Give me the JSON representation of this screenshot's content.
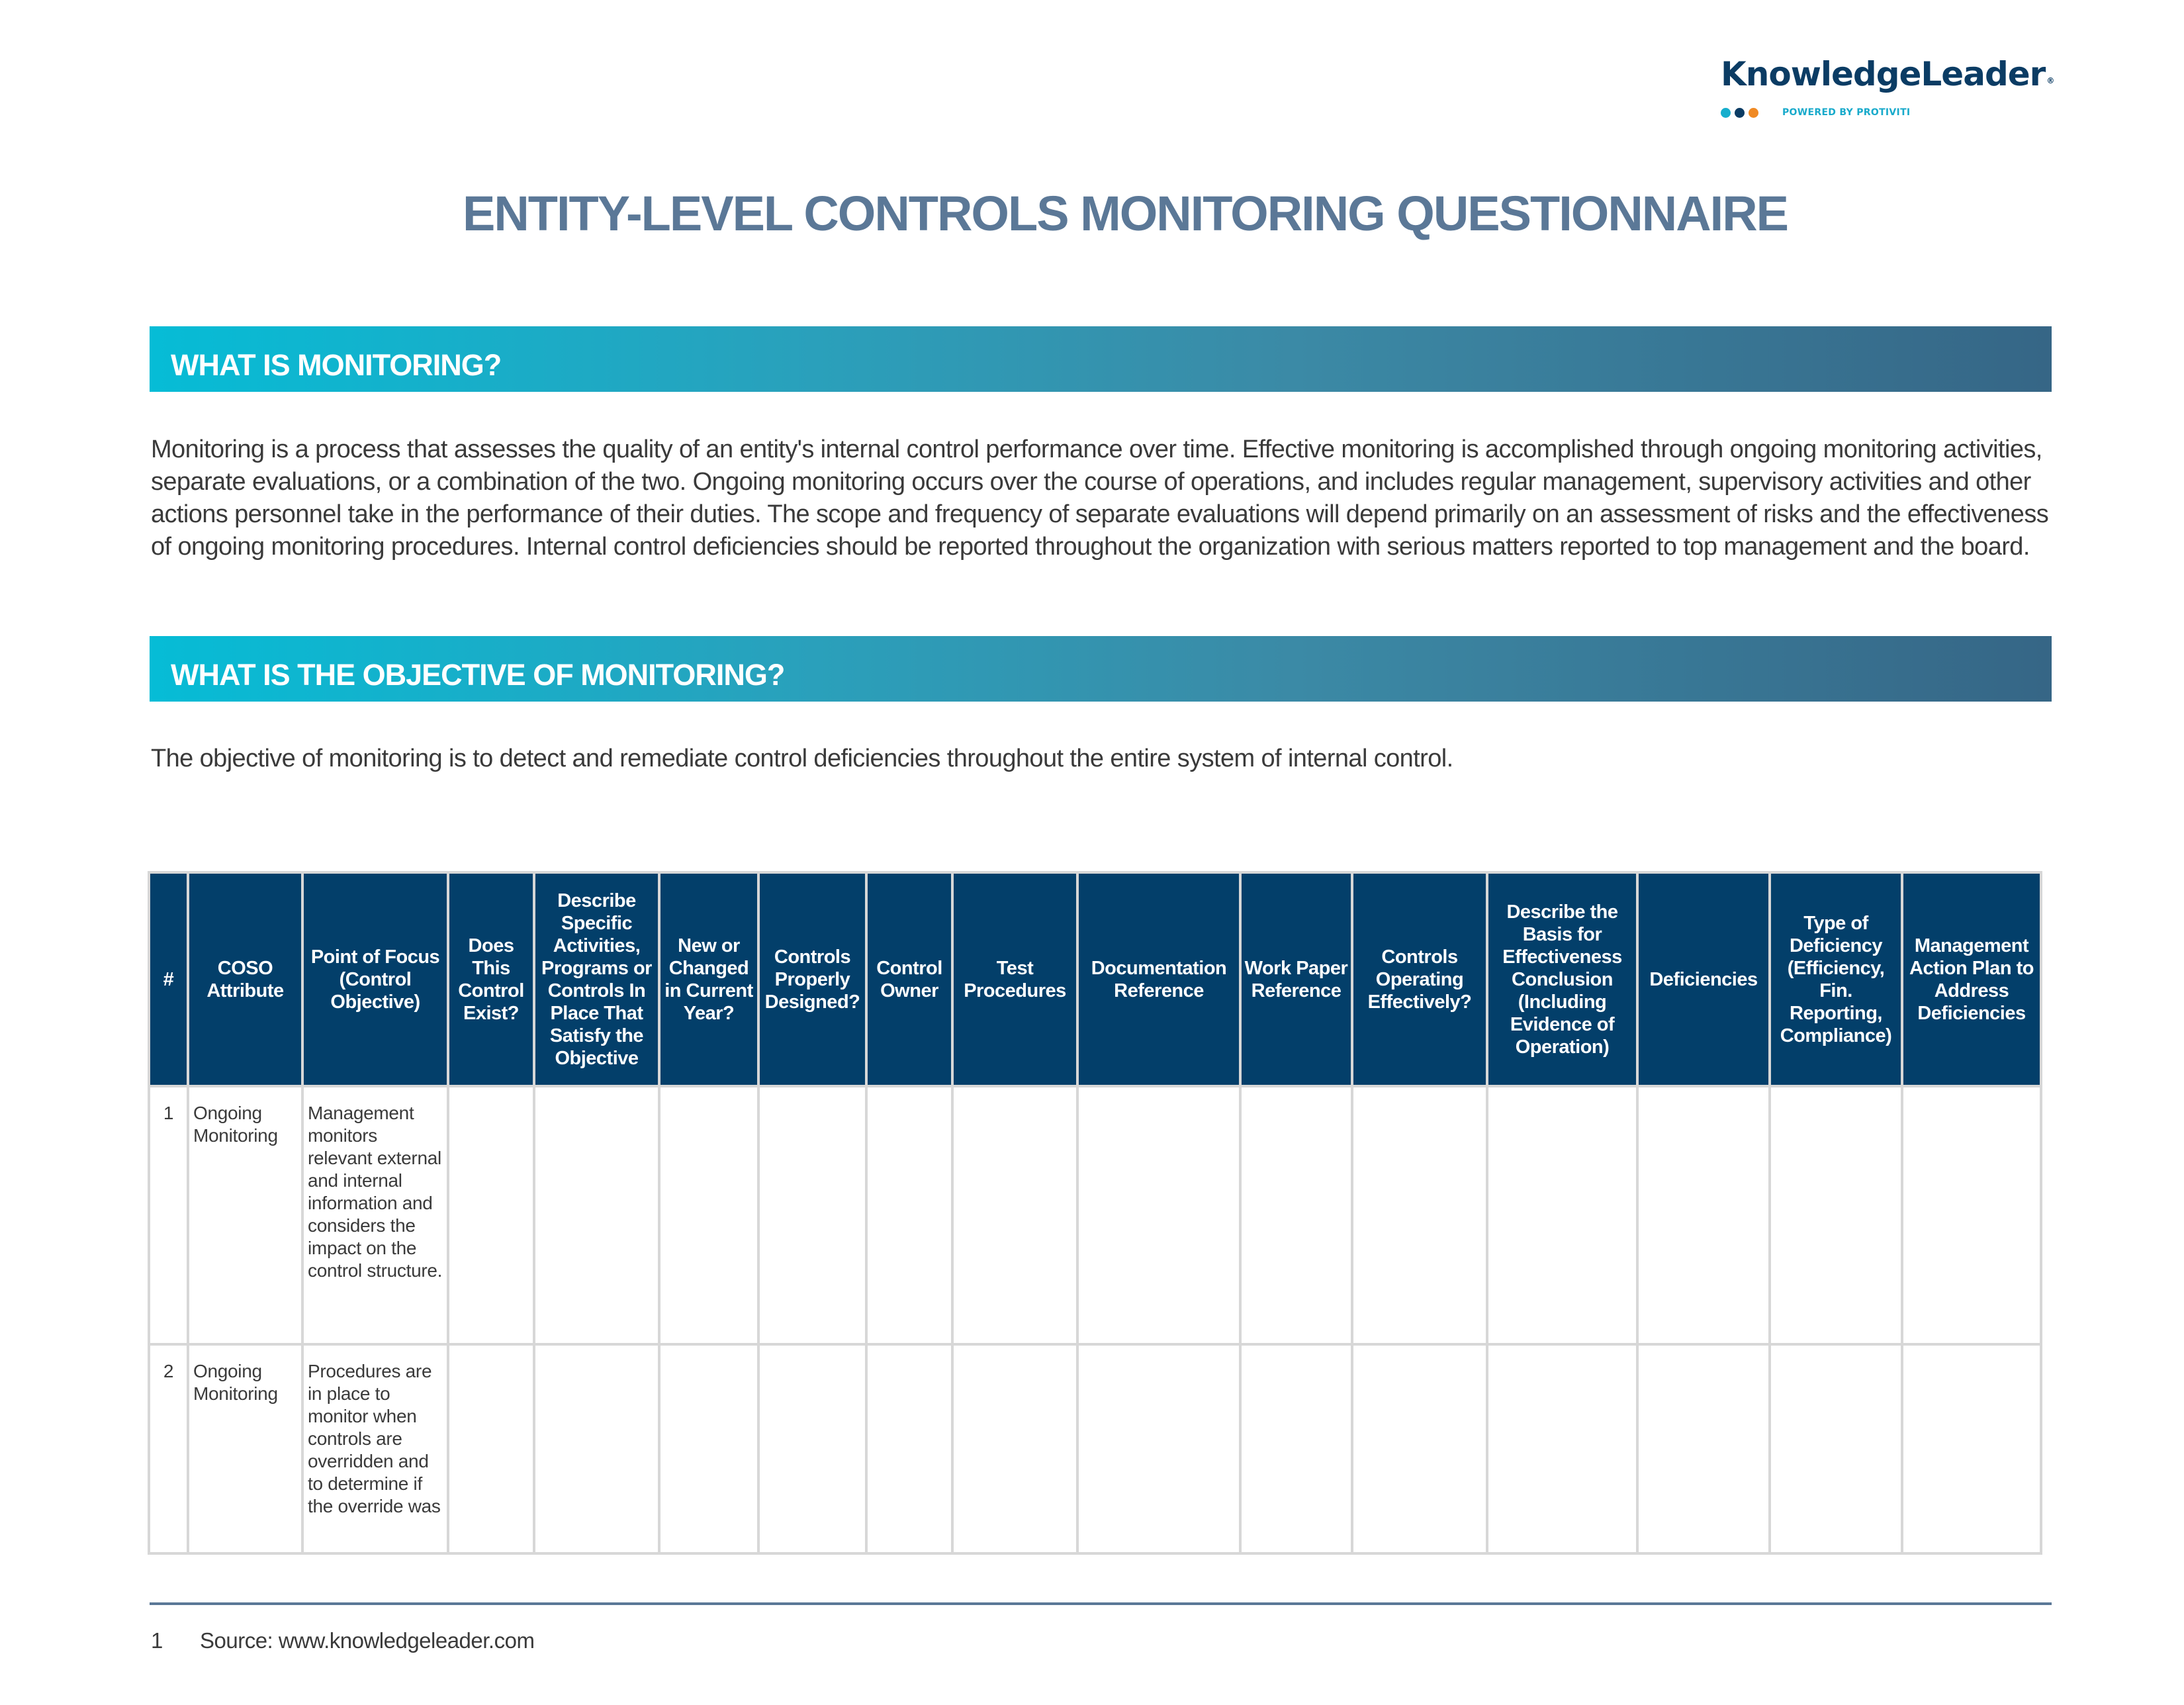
{
  "logo": {
    "name": "KnowledgeLeader",
    "registered_mark": "®",
    "tagline": "POWERED BY PROTIVITI",
    "dot_colors": [
      "#16aecd",
      "#0b3c64",
      "#f08a24"
    ]
  },
  "title": "ENTITY-LEVEL CONTROLS MONITORING QUESTIONNAIRE",
  "sections": [
    {
      "heading": "WHAT IS MONITORING?",
      "body": "Monitoring is a process that assesses the quality of an entity's internal control performance over time. Effective monitoring is accomplished through ongoing monitoring activities, separate evaluations, or a combination of the two. Ongoing monitoring occurs over the course of operations, and includes regular management, supervisory activities and other actions personnel take in the performance of their duties. The scope and frequency of separate evaluations will depend primarily on an assessment of risks and the effectiveness of ongoing monitoring procedures. Internal control deficiencies should be reported throughout the organization with serious matters reported to top management and the board."
    },
    {
      "heading": "WHAT IS THE OBJECTIVE OF MONITORING?",
      "body": "The objective of monitoring is to detect and remediate control deficiencies throughout the entire system of internal control."
    }
  ],
  "table": {
    "headers": [
      "#",
      "COSO Attribute",
      "Point of Focus (Control Objective)",
      "Does This Control Exist?",
      "Describe Specific Activities, Programs or Controls In Place That Satisfy the Objective",
      "New or Changed in Current Year?",
      "Controls Properly Designed?",
      "Control Owner",
      "Test Procedures",
      "Documentation Reference",
      "Work Paper Reference",
      "Controls Operating Effectively?",
      "Describe the Basis for Effectiveness Conclusion (Including Evidence of Operation)",
      "Deficiencies",
      "Type of Deficiency (Efficiency, Fin. Reporting, Compliance)",
      "Management Action Plan to Address Deficiencies"
    ],
    "rows": [
      {
        "number": "1",
        "coso_attribute": "Ongoing Monitoring",
        "point_of_focus": "Management monitors relevant external and internal information and considers the impact on the control structure."
      },
      {
        "number": "2",
        "coso_attribute": "Ongoing Monitoring",
        "point_of_focus": "Procedures are in place to monitor when controls are overridden and to determine if the override was"
      }
    ]
  },
  "footer": {
    "page_number": "1",
    "source": "Source: www.knowledgeleader.com"
  },
  "colors": {
    "title": "#5b7897",
    "table_header_bg": "#033f6a",
    "banner_start": "#06bcd6",
    "banner_end": "#366686",
    "footer_rule": "#5b7897"
  }
}
